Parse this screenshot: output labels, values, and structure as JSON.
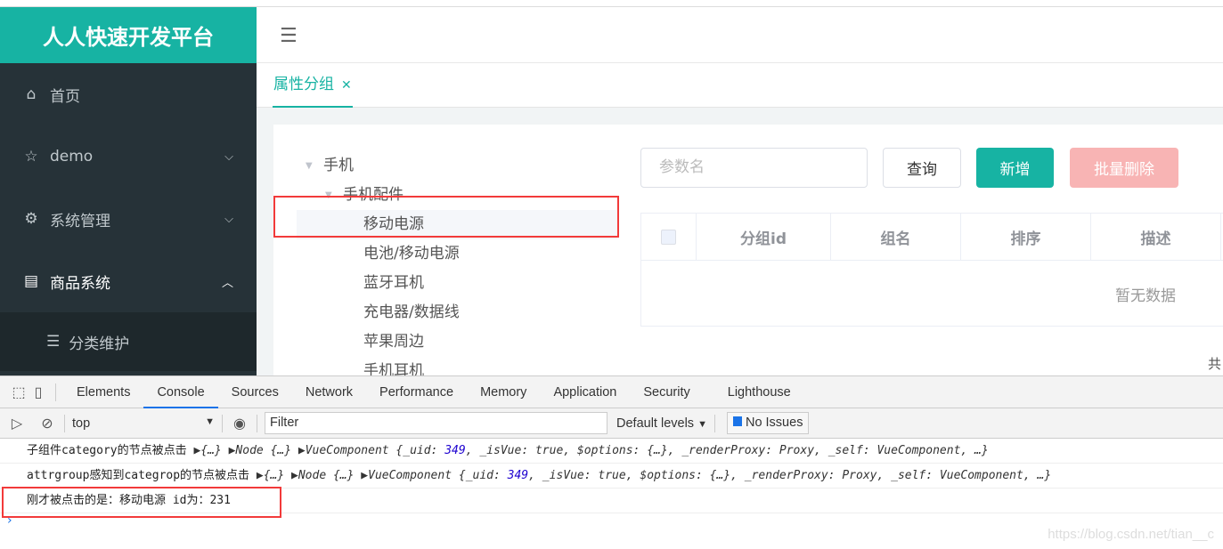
{
  "sidebar": {
    "logo": "人人快速开发平台",
    "items": [
      {
        "label": "首页",
        "icon": "home-icon"
      },
      {
        "label": "demo",
        "icon": "star-icon"
      },
      {
        "label": "系统管理",
        "icon": "gear-icon"
      },
      {
        "label": "商品系统",
        "icon": "document-icon"
      }
    ],
    "sub_items": [
      {
        "label": "分类维护",
        "icon": "list-icon"
      }
    ]
  },
  "tabs": [
    {
      "label": "属性分组",
      "active": true
    }
  ],
  "tree": {
    "root": "手机",
    "child": "手机配件",
    "leaves": [
      "移动电源",
      "电池/移动电源",
      "蓝牙耳机",
      "充电器/数据线",
      "苹果周边",
      "手机耳机"
    ],
    "selected": "移动电源"
  },
  "search": {
    "placeholder": "参数名"
  },
  "buttons": {
    "query": "查询",
    "add": "新增",
    "batch_delete": "批量删除"
  },
  "table": {
    "columns": [
      "分组id",
      "组名",
      "排序",
      "描述"
    ],
    "empty_text": "暂无数据"
  },
  "pagination": {
    "total_prefix": "共"
  },
  "devtools": {
    "tabs": [
      "Elements",
      "Console",
      "Sources",
      "Network",
      "Performance",
      "Memory",
      "Application",
      "Security",
      "Lighthouse"
    ],
    "active_tab": "Console",
    "context": "top",
    "filter_placeholder": "Filter",
    "levels": "Default levels",
    "issues": "No Issues",
    "logs": [
      {
        "text": "子组件category的节点被点击",
        "args": "▶{…} ▶Node {…} ▶VueComponent {_uid: ",
        "uid": "349",
        "rest": ", _isVue: true, $options: {…}, _renderProxy: Proxy, _self: VueComponent, …}"
      },
      {
        "text": "attrgroup感知到categrop的节点被点击",
        "args": "▶{…} ▶Node {…} ▶VueComponent {_uid: ",
        "uid": "349",
        "rest": ", _isVue: true, $options: {…}, _renderProxy: Proxy, _self: VueComponent, …}"
      },
      {
        "text": "刚才被点击的是：移动电源 id为：231"
      }
    ]
  },
  "watermark": "https://blog.csdn.net/tian__c",
  "colors": {
    "primary": "#17b3a3",
    "sidebar": "#263238",
    "danger_light": "#f8b4b4",
    "highlight": "#f23a3a"
  }
}
